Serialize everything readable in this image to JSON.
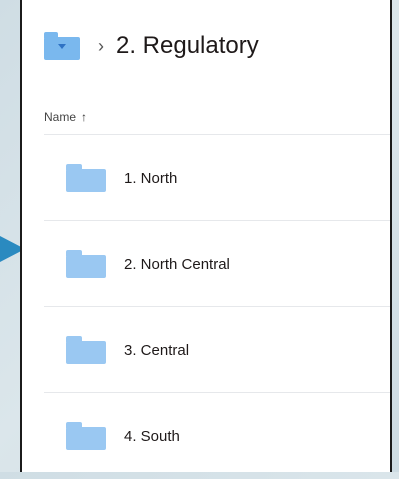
{
  "breadcrumb": {
    "separator": "›",
    "title": "2. Regulatory",
    "folder_icon": "folder-dropdown-icon"
  },
  "list": {
    "column_header": "Name",
    "sort_indicator": "↑",
    "items": [
      {
        "label": "1. North",
        "icon": "folder-icon"
      },
      {
        "label": "2. North Central",
        "icon": "folder-icon"
      },
      {
        "label": "3. Central",
        "icon": "folder-icon"
      },
      {
        "label": "4. South",
        "icon": "folder-icon"
      }
    ]
  },
  "colors": {
    "folder": "#9ac8f2",
    "header_folder": "#7ab8ee",
    "pointer": "#2a8ac0",
    "background": "#d6e2e8"
  }
}
